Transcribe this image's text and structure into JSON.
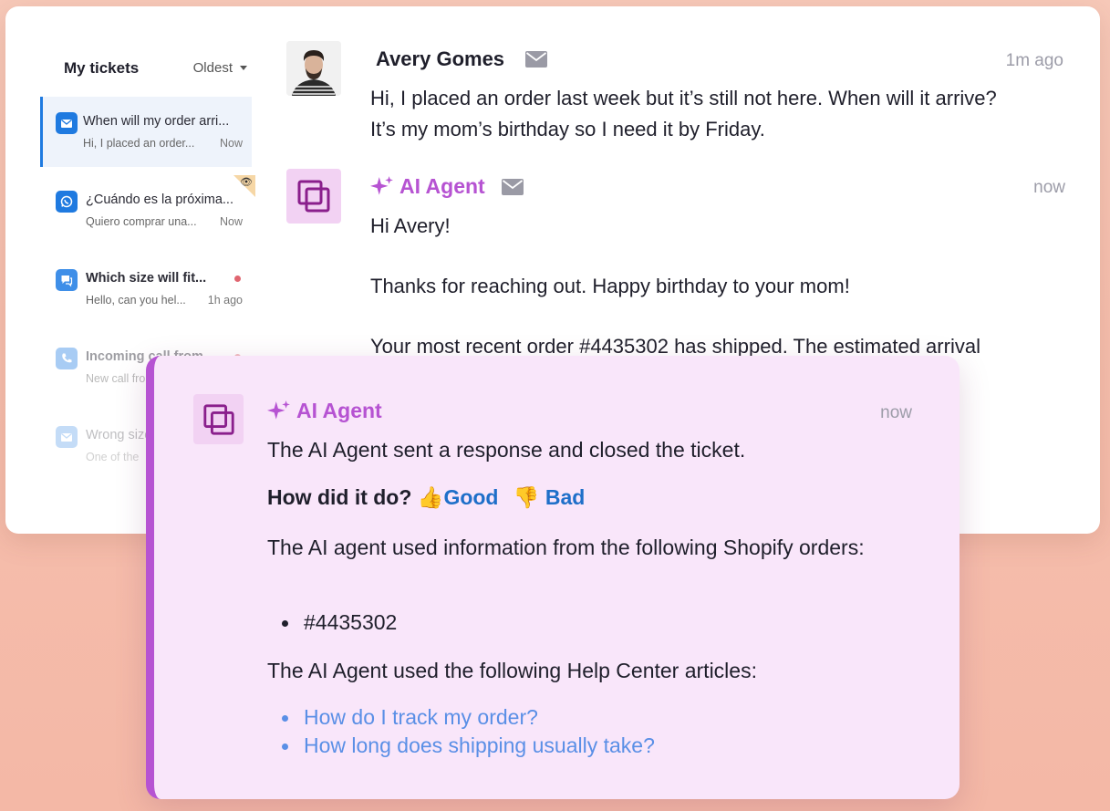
{
  "sidebar": {
    "title": "My tickets",
    "sort_label": "Oldest",
    "tickets": [
      {
        "channel": "email",
        "subject": "When will my order arri...",
        "preview": "Hi, I placed an order...",
        "time": "Now"
      },
      {
        "channel": "whatsapp",
        "subject": "¿Cuándo es la próxima...",
        "preview": "Quiero comprar una...",
        "time": "Now"
      },
      {
        "channel": "chat",
        "subject": "Which size will fit...",
        "preview": "Hello, can you hel...",
        "time": "1h ago"
      },
      {
        "channel": "phone",
        "subject": "Incoming call from...",
        "preview": "New call fro..."
      },
      {
        "channel": "email",
        "subject": "Wrong size",
        "preview": "One of the"
      }
    ]
  },
  "conversation": {
    "customer": {
      "name": "Avery Gomes",
      "time": "1m ago",
      "message_line1": "Hi, I placed an order last week but it’s still not here. When will it arrive?",
      "message_line2": "It’s my mom’s birthday so I need it by Friday."
    },
    "agent": {
      "name": "AI Agent",
      "time": "now",
      "greeting": "Hi Avery!",
      "line2": "Thanks for reaching out. Happy birthday to your mom!",
      "line3": "Your most recent order #4435302 has shipped. The estimated arrival"
    }
  },
  "overlay": {
    "agent_name": "AI Agent",
    "time": "now",
    "status": "The AI Agent sent a response and closed the ticket.",
    "rating_question": "How did it do?",
    "good_emoji": "👍",
    "good_label": "Good",
    "bad_emoji": "👎",
    "bad_label": "Bad",
    "shopify_text": "The AI agent used information from the following Shopify orders:",
    "orders": [
      "#4435302"
    ],
    "articles_text": "The AI Agent used the following Help Center articles:",
    "articles": [
      "How do I track my order?",
      "How long does shipping usually take?"
    ]
  },
  "colors": {
    "accent_blue": "#1f7ae0",
    "ai_purple": "#b653d2",
    "link_blue": "#5a8fe6",
    "overlay_bg": "#f9e6fa"
  }
}
